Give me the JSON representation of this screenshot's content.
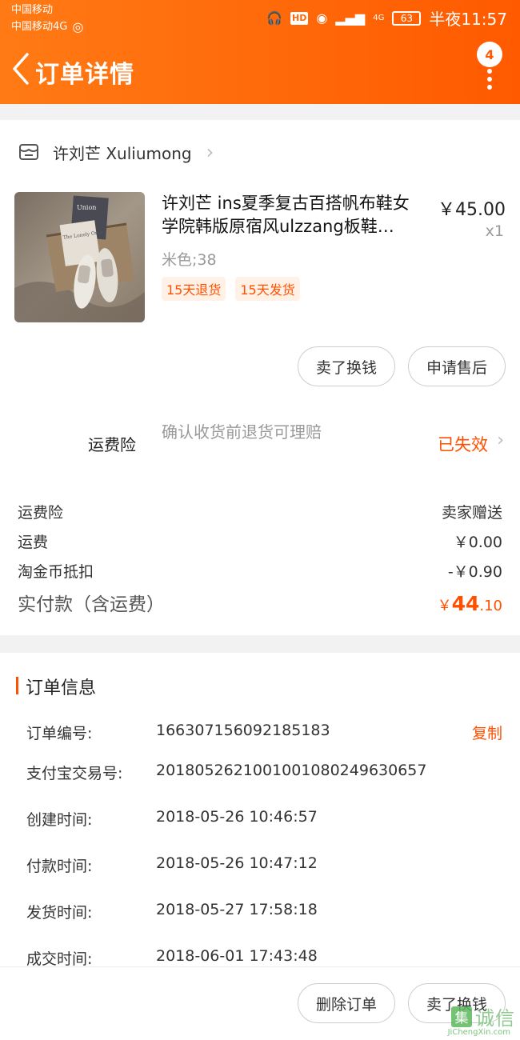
{
  "status_bar": {
    "carrier_1": "中国移动",
    "carrier_2": "中国移动4G",
    "network_hd": "HD",
    "signal_label": "4G",
    "battery": "63",
    "time": "半夜11:57"
  },
  "nav": {
    "title": "订单详情",
    "badge_count": "4"
  },
  "shop": {
    "name": "许刘芒 Xuliumong"
  },
  "product": {
    "title": "许刘芒 ins夏季复古百搭帆布鞋女学院韩版原宿风ulzzang板鞋…",
    "price": "￥45.00",
    "quantity": "x1",
    "sku": "米色;38",
    "tags": [
      "15天退货",
      "15天发货"
    ],
    "image_text_1": "Union",
    "image_text_2": "The Lonely Ones"
  },
  "actions": {
    "sell_for_cash": "卖了换钱",
    "apply_after_sale": "申请售后",
    "delete_order": "删除订单"
  },
  "shipping_insurance": {
    "label": "运费险",
    "description": "确认收货前退货可理赔",
    "status": "已失效"
  },
  "fees": {
    "insurance_label": "运费险",
    "insurance_value": "卖家赠送",
    "shipping_label": "运费",
    "shipping_value": "￥0.00",
    "coin_label": "淘金币抵扣",
    "coin_value": "-￥0.90",
    "total_label": "实付款（含运费）",
    "total_currency": "￥",
    "total_int": "44",
    "total_dec": ".10"
  },
  "order_info": {
    "title": "订单信息",
    "copy_label": "复制",
    "rows": [
      {
        "key": "订单编号:",
        "value": "166307156092185183"
      },
      {
        "key": "支付宝交易号:",
        "value": "2018052621001001080249630657"
      },
      {
        "key": "创建时间:",
        "value": "2018-05-26 10:46:57"
      },
      {
        "key": "付款时间:",
        "value": "2018-05-26 10:47:12"
      },
      {
        "key": "发货时间:",
        "value": "2018-05-27 17:58:18"
      },
      {
        "key": "成交时间:",
        "value": "2018-06-01 17:43:48"
      }
    ]
  },
  "watermark": {
    "logo": "集",
    "text": "诚信",
    "url": "JiChengXin.com"
  },
  "colors": {
    "brand_orange": "#ff5000",
    "header_start": "#ff7a14",
    "header_end": "#ff5a00"
  }
}
